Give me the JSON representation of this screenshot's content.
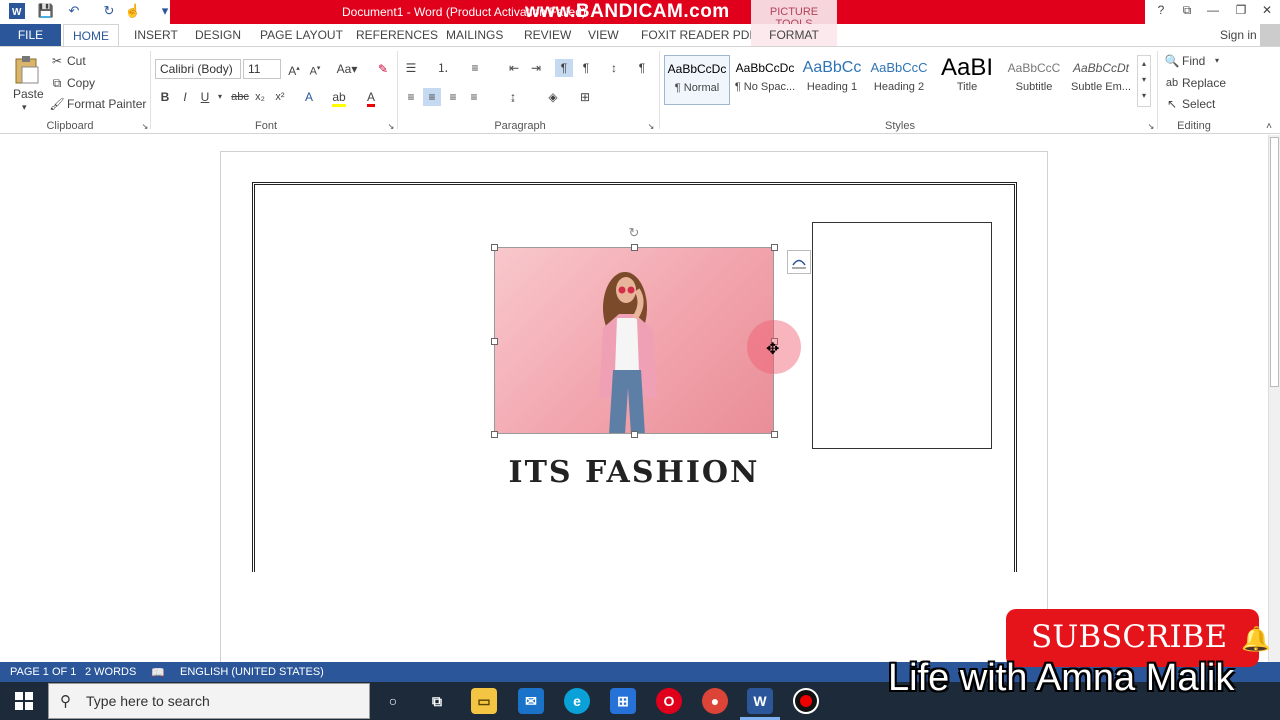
{
  "title_bar": {
    "doc_title": "Document1 - Word (Product Activation Failed)",
    "watermark_bandicam": "www.BANDICAM.com",
    "contextual_tab": "PICTURE TOOLS",
    "controls": [
      "?",
      "⧉",
      "—",
      "❐",
      "✕"
    ]
  },
  "tabs": {
    "file": "FILE",
    "home": "HOME",
    "others": [
      "INSERT",
      "DESIGN",
      "PAGE LAYOUT",
      "REFERENCES",
      "MAILINGS",
      "REVIEW",
      "VIEW",
      "FOXIT READER PDF"
    ],
    "format": "FORMAT",
    "sign_in": "Sign in"
  },
  "ribbon": {
    "clipboard": {
      "label": "Clipboard",
      "paste": "Paste",
      "cut": "Cut",
      "copy": "Copy",
      "format_painter": "Format Painter"
    },
    "font": {
      "label": "Font",
      "font_name": "Calibri (Body)",
      "font_size": "11"
    },
    "paragraph": {
      "label": "Paragraph"
    },
    "styles": {
      "label": "Styles",
      "items": [
        {
          "preview": "AaBbCcDc",
          "name": "¶ Normal"
        },
        {
          "preview": "AaBbCcDc",
          "name": "¶ No Spac..."
        },
        {
          "preview": "AaBbCc",
          "name": "Heading 1"
        },
        {
          "preview": "AaBbCcC",
          "name": "Heading 2"
        },
        {
          "preview": "AaBI",
          "name": "Title"
        },
        {
          "preview": "AaBbCcC",
          "name": "Subtitle"
        },
        {
          "preview": "AaBbCcDt",
          "name": "Subtle Em..."
        }
      ]
    },
    "editing": {
      "label": "Editing",
      "find": "Find",
      "replace": "Replace",
      "select": "Select"
    }
  },
  "document": {
    "heading": "ITS FASHION"
  },
  "status_bar": {
    "page": "PAGE 1 OF 1",
    "words": "2 WORDS",
    "language": "ENGLISH (UNITED STATES)"
  },
  "taskbar": {
    "search_placeholder": "Type here to search"
  },
  "overlay": {
    "subscribe": "SUBSCRIBE",
    "channel": "Life with Amna Malik"
  },
  "colors": {
    "word_blue": "#2b579a",
    "title_red": "#e0001b",
    "picture_tools_pink": "#f7d5dc"
  }
}
